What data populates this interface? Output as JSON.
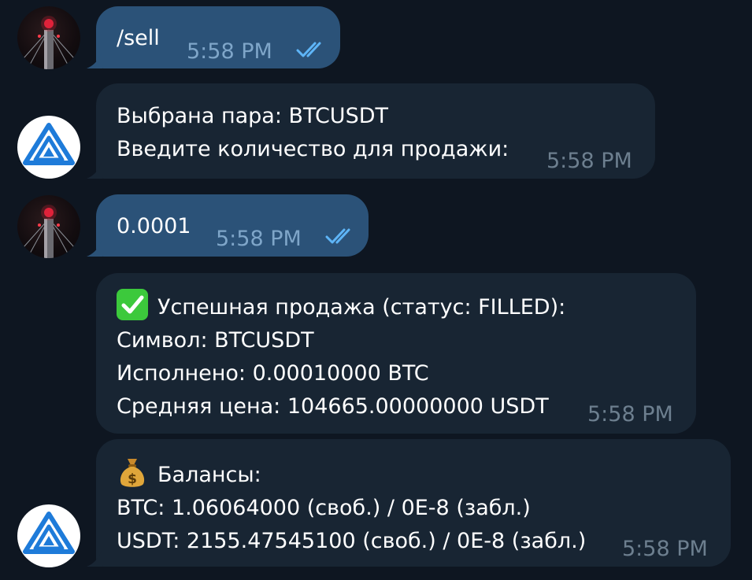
{
  "messages": [
    {
      "id": "m1",
      "direction": "out",
      "lines": [
        "/sell"
      ],
      "time": "5:58 PM",
      "read": true
    },
    {
      "id": "m2",
      "direction": "in",
      "lines": [
        "Выбрана пара: BTCUSDT",
        "Введите количество для продажи:"
      ],
      "time": "5:58 PM"
    },
    {
      "id": "m3",
      "direction": "out",
      "lines": [
        "0.0001"
      ],
      "time": "5:58 PM",
      "read": true
    },
    {
      "id": "m4",
      "direction": "in",
      "emoji": "white-check-mark",
      "lines": [
        "Успешная продажа (статус: FILLED):",
        "Символ: BTCUSDT",
        "Исполнено: 0.00010000 BTC",
        "Средняя цена: 104665.00000000 USDT"
      ],
      "time": "5:58 PM"
    },
    {
      "id": "m5",
      "direction": "in",
      "emoji": "money-bag",
      "lines": [
        "Балансы:",
        "BTC: 1.06064000 (своб.) / 0E-8 (забл.)",
        "USDT: 2155.47545100 (своб.) / 0E-8 (забл.)"
      ],
      "time": "5:58 PM"
    }
  ],
  "colors": {
    "background": "#0e1621",
    "outgoing_bubble": "#2b5278",
    "incoming_bubble": "#182533",
    "read_ticks": "#5eb5f7",
    "bot_logo": "#1e7bd9"
  }
}
